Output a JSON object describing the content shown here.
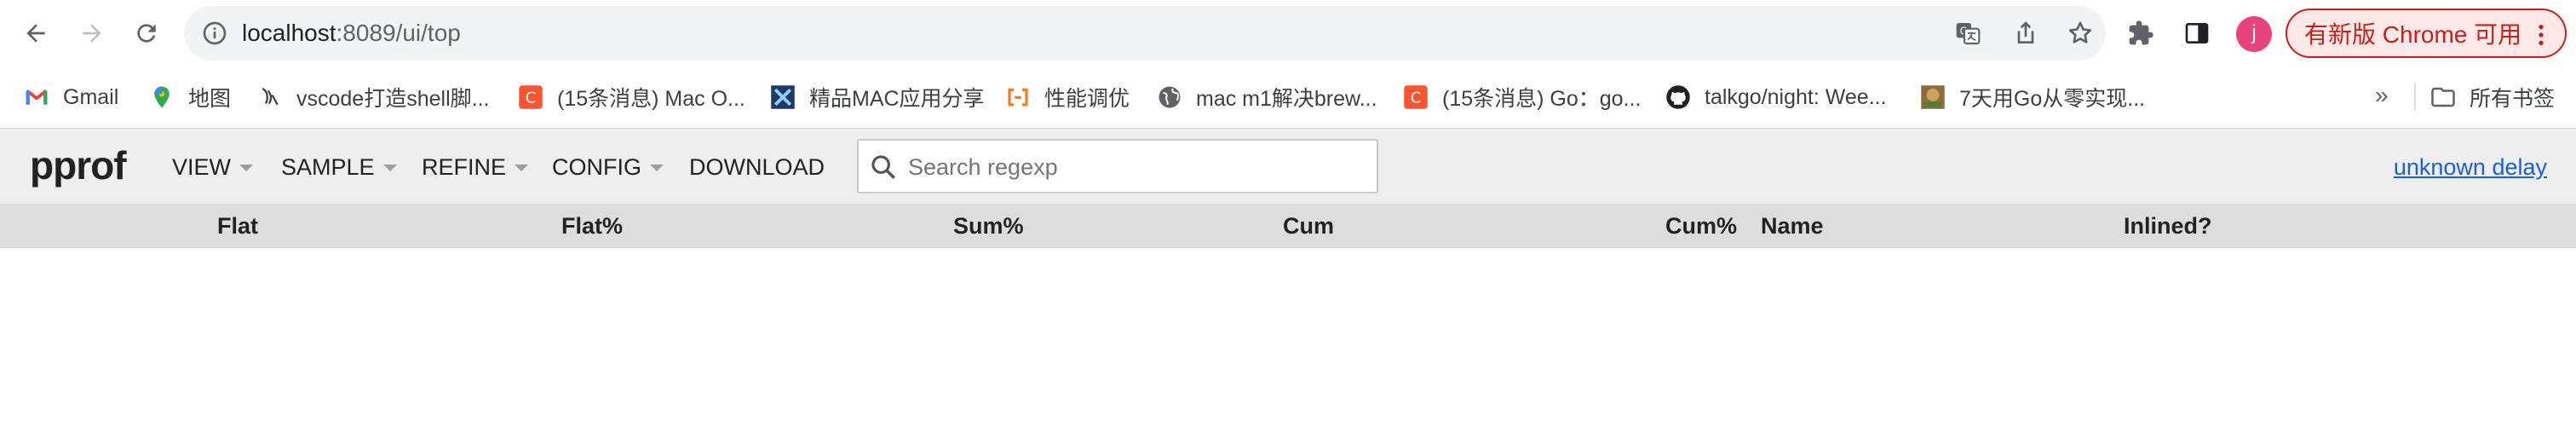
{
  "browser": {
    "url_host": "localhost",
    "url_path": ":8089/ui/top",
    "avatar_letter": "j",
    "update_button_label": "有新版 Chrome 可用",
    "accent_color": "#c5221f"
  },
  "bookmarks": {
    "items": [
      {
        "label": "Gmail",
        "icon": "gmail-icon"
      },
      {
        "label": "地图",
        "icon": "maps-icon"
      },
      {
        "label": "vscode打造shell脚...",
        "icon": "vscode-bookmark-icon"
      },
      {
        "label": "(15条消息) Mac O...",
        "icon": "csdn-icon"
      },
      {
        "label": "精品MAC应用分享",
        "icon": "x-app-icon"
      },
      {
        "label": "性能调优",
        "icon": "brackets-icon"
      },
      {
        "label": "mac m1解决brew...",
        "icon": "globe-icon"
      },
      {
        "label": "(15条消息) Go：go...",
        "icon": "csdn-icon"
      },
      {
        "label": "talkgo/night: Wee...",
        "icon": "github-icon"
      },
      {
        "label": "7天用Go从零实现...",
        "icon": "thumbnail-icon"
      }
    ],
    "overflow": "»",
    "all_bookmarks_label": "所有书签"
  },
  "pprof": {
    "title": "pprof",
    "menus": [
      "VIEW",
      "SAMPLE",
      "REFINE",
      "CONFIG",
      "DOWNLOAD"
    ],
    "search_placeholder": "Search regexp",
    "delay_link": "unknown delay"
  },
  "table": {
    "columns": [
      "Flat",
      "Flat%",
      "Sum%",
      "Cum",
      "Cum%",
      "Name",
      "Inlined?"
    ],
    "rows": []
  }
}
